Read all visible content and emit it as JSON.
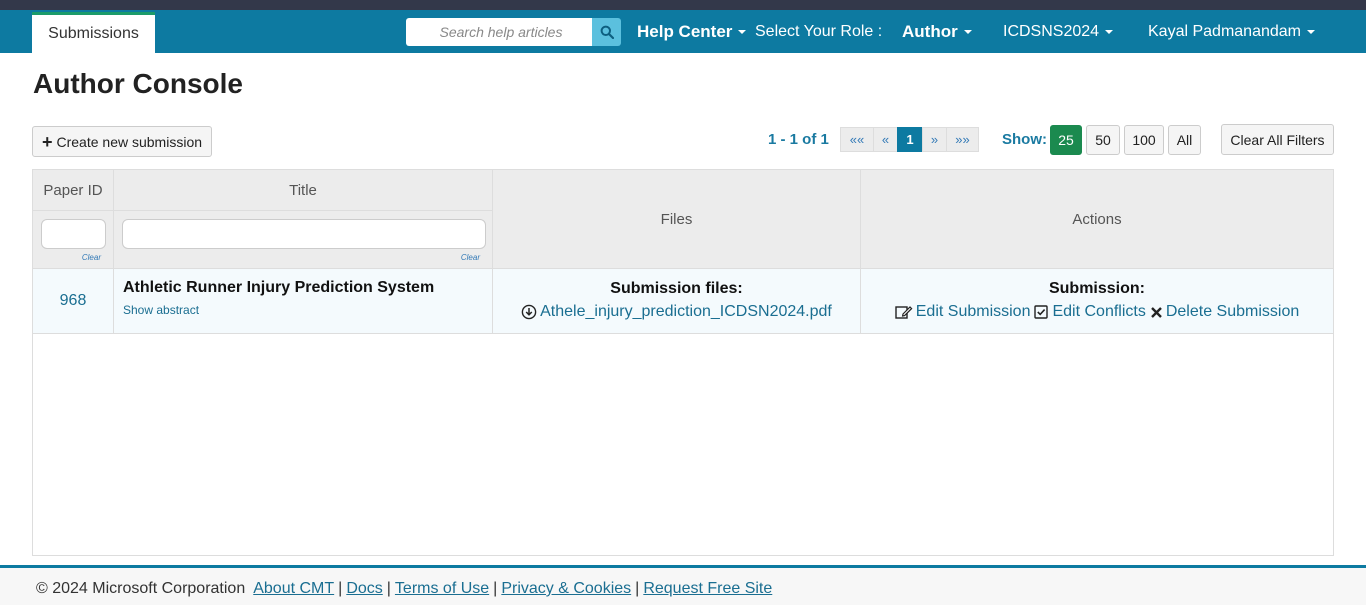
{
  "nav": {
    "tab_submissions": "Submissions",
    "search_placeholder": "Search help articles",
    "help_center": "Help Center",
    "role_label": "Select Your Role :",
    "role_value": "Author",
    "conference": "ICDSNS2024",
    "user": "Kayal Padmanandam"
  },
  "page": {
    "title": "Author Console",
    "create_button": "Create new submission",
    "range": "1 - 1 of 1",
    "pager": {
      "first": "««",
      "prev": "«",
      "current": "1",
      "next": "»",
      "last": "»»"
    },
    "show_label": "Show:",
    "show_options": [
      "25",
      "50",
      "100",
      "All"
    ],
    "show_selected": "25",
    "clear_filters": "Clear All Filters"
  },
  "table": {
    "headers": {
      "paper_id": "Paper ID",
      "title": "Title",
      "files": "Files",
      "actions": "Actions"
    },
    "clear_label": "Clear",
    "rows": [
      {
        "paper_id": "968",
        "title": "Athletic Runner Injury Prediction System",
        "show_abstract": "Show abstract",
        "files_heading": "Submission files:",
        "file_name": "Athele_injury_prediction_ICDSN2024.pdf",
        "actions_heading": "Submission:",
        "edit_submission": "Edit Submission",
        "edit_conflicts": "Edit Conflicts",
        "delete_submission": "Delete Submission"
      }
    ]
  },
  "footer": {
    "copyright": "© 2024 Microsoft Corporation",
    "links": [
      "About CMT",
      "Docs",
      "Terms of Use",
      "Privacy & Cookies",
      "Request Free Site"
    ]
  },
  "colors": {
    "navbar": "#0d7aa1",
    "accent_green": "#1b8a4f",
    "link": "#1a6e91"
  }
}
